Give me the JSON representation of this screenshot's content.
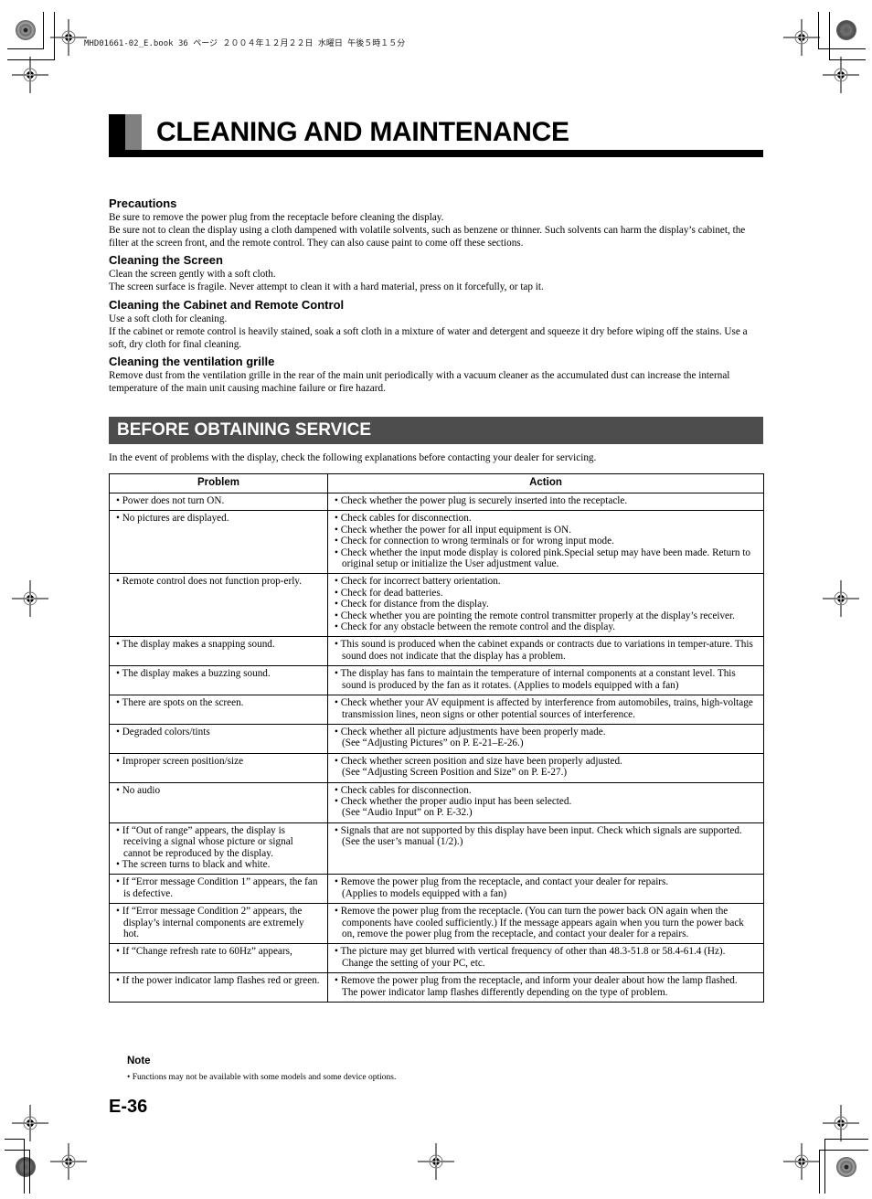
{
  "print_slug": "MHD01661-02_E.book  36 ページ  ２００４年１２月２２日  水曜日  午後５時１５分",
  "title": "CLEANING AND MAINTENANCE",
  "cleaning_sections": [
    {
      "heading": "Precautions",
      "paragraphs": [
        "Be sure to remove the power plug from the receptacle before cleaning the display.",
        "Be sure not to clean the display using a cloth dampened with volatile solvents, such as benzene or thinner.  Such solvents can harm the display’s cabinet, the filter at the screen front, and the remote control.  They can also cause paint to come off these sections."
      ]
    },
    {
      "heading": "Cleaning the Screen",
      "paragraphs": [
        "Clean the screen gently with a soft cloth.",
        "The screen surface is fragile.  Never attempt to clean it with a hard material, press on it forcefully, or tap it."
      ]
    },
    {
      "heading": "Cleaning the Cabinet and Remote Control",
      "paragraphs": [
        "Use a soft cloth for cleaning.",
        "If the cabinet or remote control is heavily stained, soak a soft cloth in a mixture of water  and detergent and squeeze it dry before wiping off the stains.  Use a soft, dry cloth for final cleaning."
      ]
    },
    {
      "heading": "Cleaning the ventilation grille",
      "paragraphs": [
        "Remove dust from the ventilation grille in the rear of the main unit periodically with a vacuum cleaner as the accumulated dust can increase the internal temperature of the main unit causing machine failure or fire hazard."
      ]
    }
  ],
  "service": {
    "heading": "BEFORE OBTAINING SERVICE",
    "intro": "In the event of problems with the display, check the following explanations before contacting your dealer for servicing.",
    "table": {
      "headers": [
        "Problem",
        "Action"
      ],
      "rows": [
        {
          "problem": [
            "• Power does not turn ON."
          ],
          "action": [
            "• Check whether the power plug is securely inserted into the receptacle."
          ]
        },
        {
          "problem": [
            "• No pictures are displayed."
          ],
          "action": [
            "• Check cables for disconnection.",
            "• Check whether the power for all input equipment is ON.",
            "• Check for connection to wrong terminals or for wrong input mode.",
            "• Check whether the input mode display is colored pink.Special setup may have been made. Return to original setup or initialize the User adjustment value."
          ]
        },
        {
          "problem": [
            "• Remote control does not function prop-erly."
          ],
          "action": [
            "• Check for incorrect battery orientation.",
            "• Check for dead batteries.",
            "• Check for distance from the display.",
            "• Check whether you are pointing the remote control transmitter properly at the display’s receiver.",
            "• Check for any obstacle between the remote control and the display."
          ]
        },
        {
          "problem": [
            "• The display makes a snapping sound."
          ],
          "action": [
            "• This sound is produced when the cabinet expands or contracts due to variations in temper-ature.  This sound does not indicate that the display has a problem."
          ]
        },
        {
          "problem": [
            "• The display makes a buzzing sound."
          ],
          "action": [
            "• The display has fans to maintain the temperature of internal components at a constant level.  This sound is produced by the fan as it rotates. (Applies to models equipped with a fan)"
          ]
        },
        {
          "problem": [
            "• There are spots on the screen."
          ],
          "action": [
            "• Check whether your AV equipment is affected by interference from automobiles, trains, high-voltage transmission lines, neon signs or other potential sources of interference."
          ]
        },
        {
          "problem": [
            "• Degraded colors/tints"
          ],
          "action": [
            "• Check whether all picture adjustments have been properly made.",
            "(See “Adjusting Pictures” on P. E-21–E-26.)"
          ]
        },
        {
          "problem": [
            "• Improper screen position/size"
          ],
          "action": [
            "• Check whether screen position and size have been properly adjusted.",
            "(See “Adjusting Screen Position and Size” on P. E-27.)"
          ]
        },
        {
          "problem": [
            "• No audio"
          ],
          "action": [
            "• Check cables for disconnection.",
            "• Check whether the proper audio input has been selected.",
            "(See “Audio Input” on P. E-32.)"
          ]
        },
        {
          "problem": [
            "• If “Out of range” appears, the display is receiving a signal whose picture or signal cannot be reproduced by the display.",
            "• The screen turns to black and white."
          ],
          "action": [
            "• Signals that are not supported by this display have been input. Check which signals are supported. (See the user’s manual (1/2).)"
          ]
        },
        {
          "problem": [
            "• If “Error message Condition 1” appears, the fan is defective."
          ],
          "action": [
            "• Remove the power plug from the receptacle, and contact your dealer for repairs.",
            "(Applies to models equipped with a fan)"
          ]
        },
        {
          "problem": [
            "• If “Error message Condition 2” appears, the display’s internal components are extremely hot."
          ],
          "action": [
            "• Remove the power plug from the receptacle.  (You can turn the power back ON again when the components have cooled sufficiently.)  If the message appears again when you turn the power back on, remove the power plug from the receptacle, and contact your dealer for a repairs."
          ]
        },
        {
          "problem": [
            "• If “Change refresh rate to 60Hz” appears,"
          ],
          "action": [
            "• The picture may get blurred with vertical frequency of other than 48.3-51.8 or 58.4-61.4 (Hz). Change the setting of your PC, etc."
          ]
        },
        {
          "problem": [
            "• If the power indicator lamp flashes red or green."
          ],
          "action": [
            "• Remove the power plug from the receptacle, and inform your dealer about how the lamp flashed.",
            "The power indicator lamp flashes differently depending on the type of problem."
          ]
        }
      ]
    }
  },
  "note": {
    "heading": "Note",
    "text": "•  Functions may not be available with some models and some device options."
  },
  "page_number": "E-36",
  "colors": {
    "heading_bar": "#4d4d4d",
    "accent_gray": "#808080",
    "rule": "#000000"
  }
}
